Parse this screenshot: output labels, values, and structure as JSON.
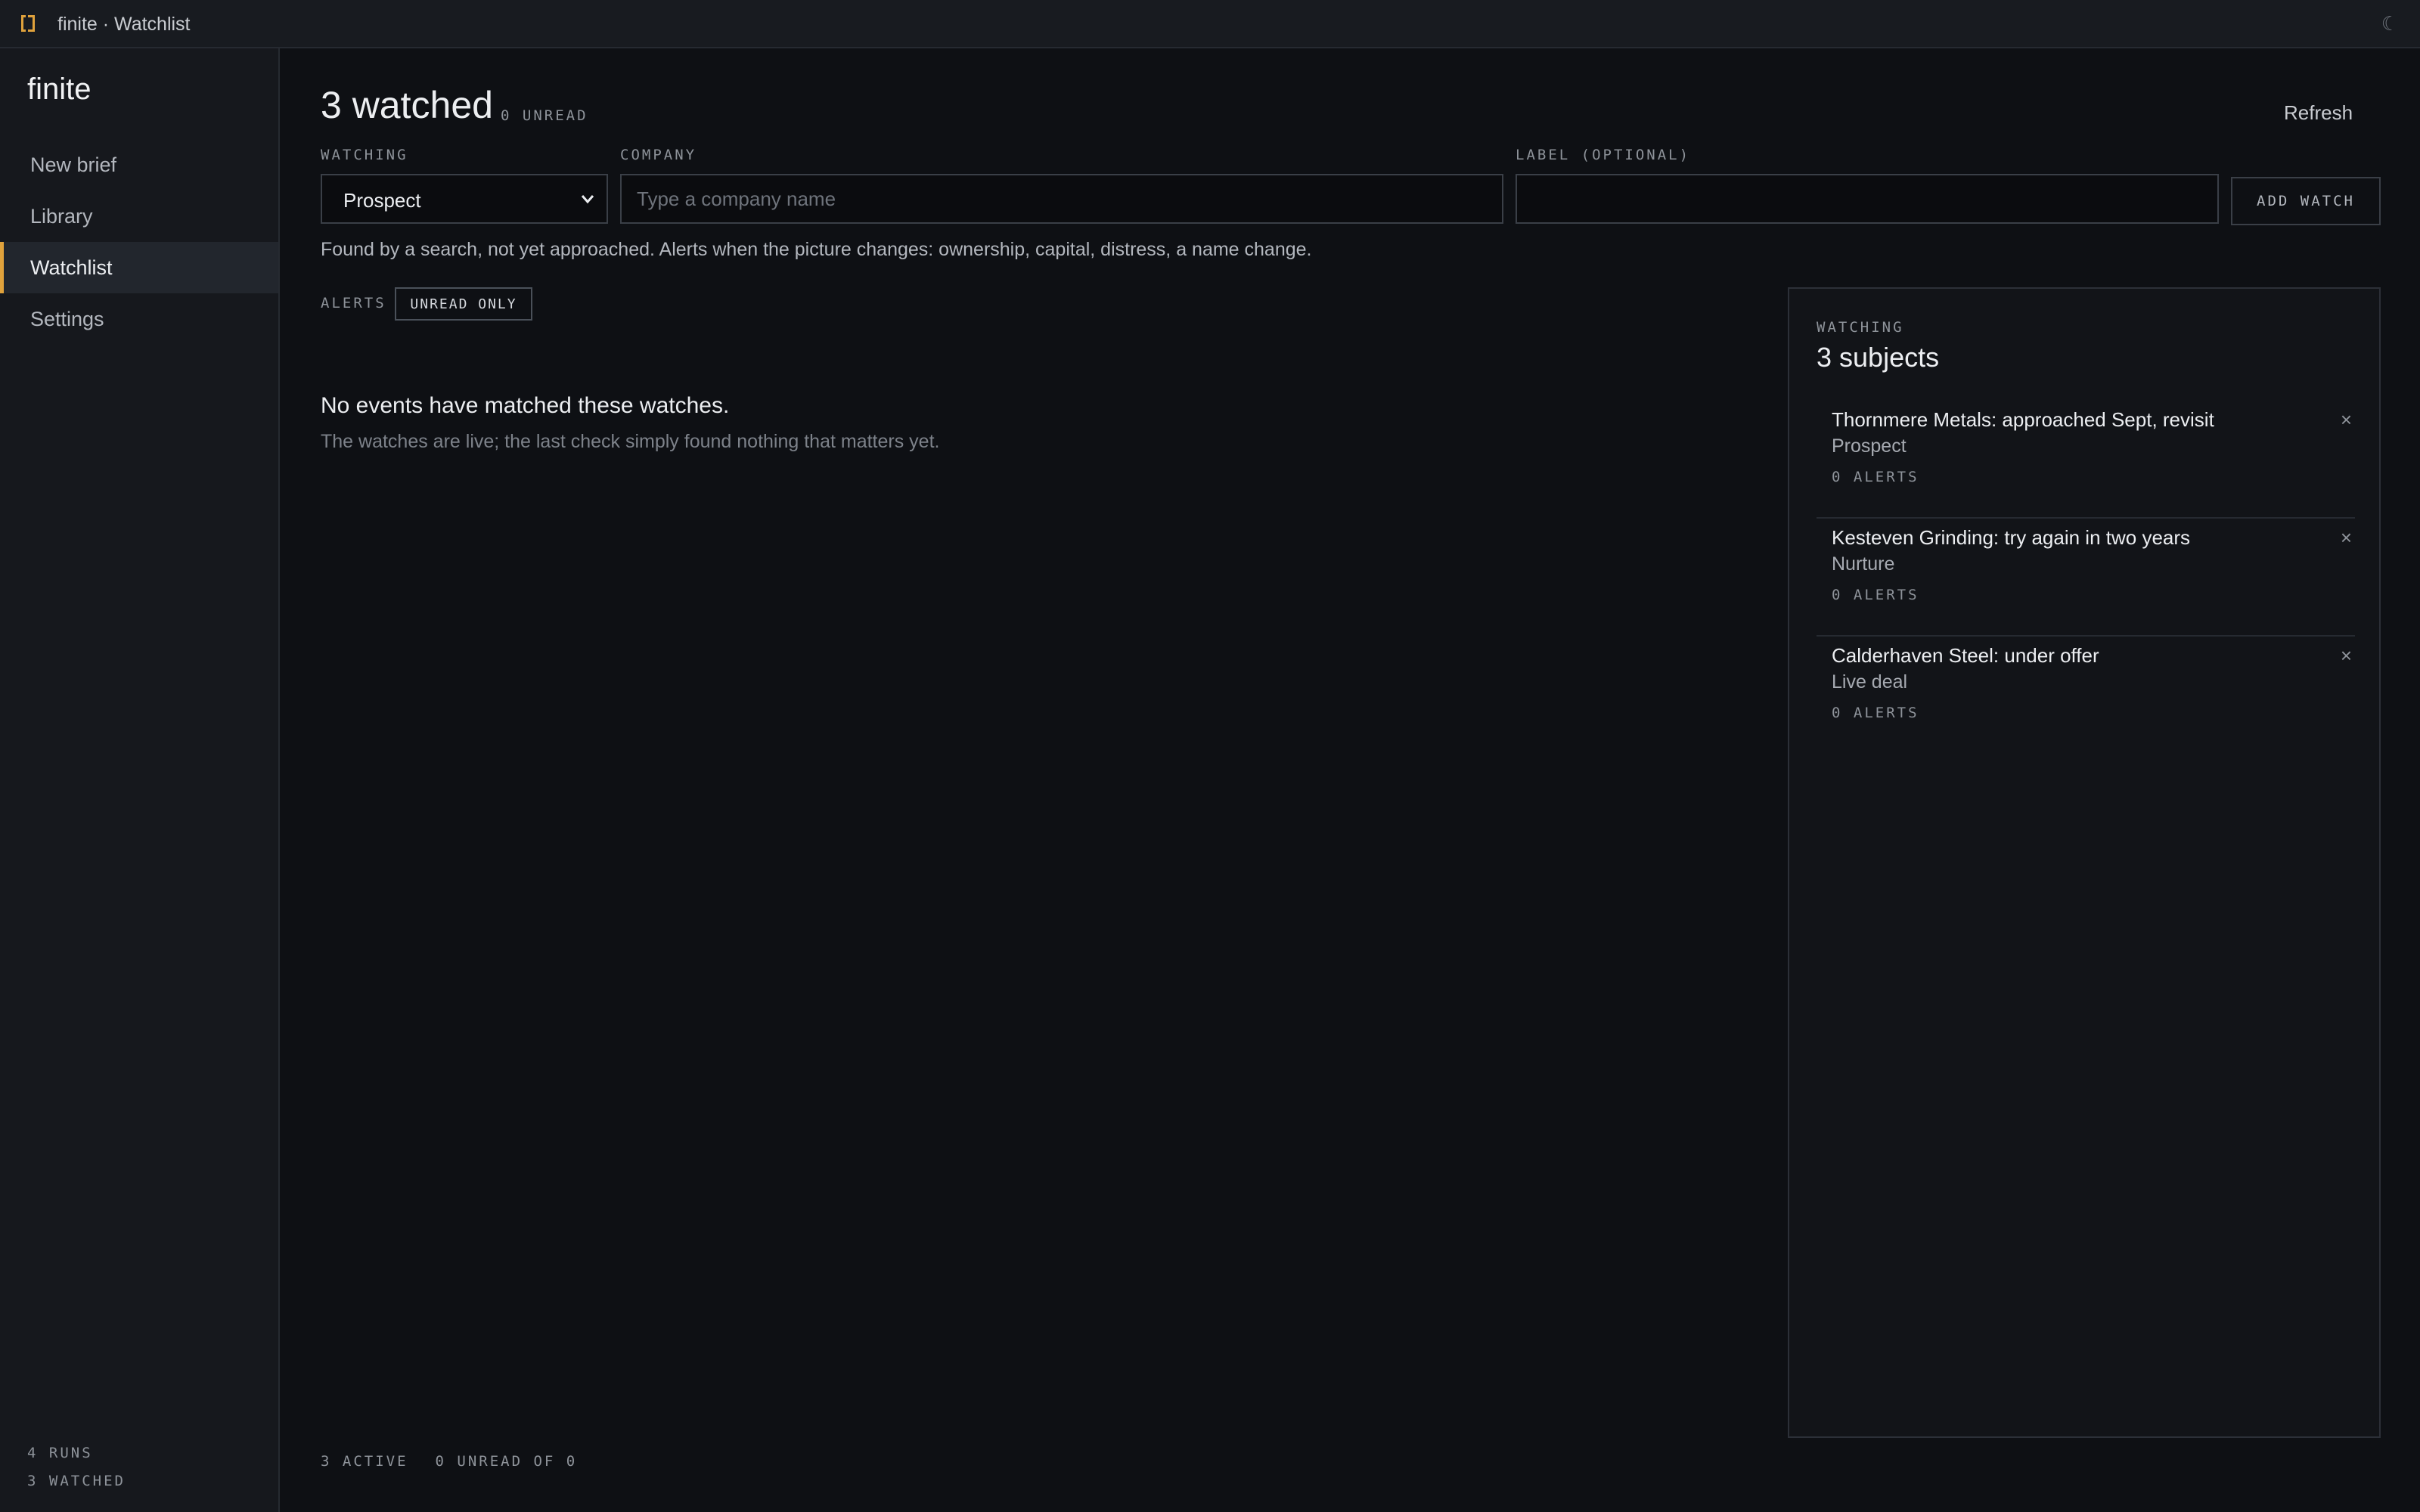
{
  "window": {
    "title": "finite · Watchlist"
  },
  "sidebar": {
    "brand": "finite",
    "items": [
      {
        "label": "New brief",
        "active": false
      },
      {
        "label": "Library",
        "active": false
      },
      {
        "label": "Watchlist",
        "active": true
      },
      {
        "label": "Settings",
        "active": false
      }
    ],
    "stats": {
      "runs": "4 RUNS",
      "watched": "3 WATCHED"
    }
  },
  "header": {
    "title": "3 watched",
    "unread": "0 UNREAD",
    "refresh_label": "Refresh"
  },
  "form": {
    "watching_label": "WATCHING",
    "watching_value": "Prospect",
    "company_label": "COMPANY",
    "company_placeholder": "Type a company name",
    "company_value": "",
    "label_label": "LABEL (OPTIONAL)",
    "label_value": "",
    "add_label": "ADD WATCH",
    "helper": "Found by a search, not yet approached. Alerts when the picture changes: ownership, capital, distress, a name change."
  },
  "alerts": {
    "label": "ALERTS",
    "toggle_label": "UNREAD ONLY",
    "empty_title": "No events have matched these watches.",
    "empty_sub": "The watches are live; the last check simply found nothing that matters yet."
  },
  "footer": {
    "active": "3 ACTIVE",
    "unread": "0 UNREAD OF 0"
  },
  "panel": {
    "label": "WATCHING",
    "title": "3 subjects",
    "items": [
      {
        "name": "Thornmere Metals: approached Sept, revisit",
        "status": "Prospect",
        "alerts": "0 ALERTS"
      },
      {
        "name": "Kesteven Grinding: try again in two years",
        "status": "Nurture",
        "alerts": "0 ALERTS"
      },
      {
        "name": "Calderhaven Steel: under offer",
        "status": "Live deal",
        "alerts": "0 ALERTS"
      }
    ]
  },
  "colors": {
    "accent": "#e0a23c",
    "background": "#0e1014",
    "sidebar": "#16181d"
  },
  "icons": {
    "app": "app-logo-icon",
    "theme": "moon-icon",
    "select": "chevron-down-icon",
    "remove": "close-icon"
  }
}
